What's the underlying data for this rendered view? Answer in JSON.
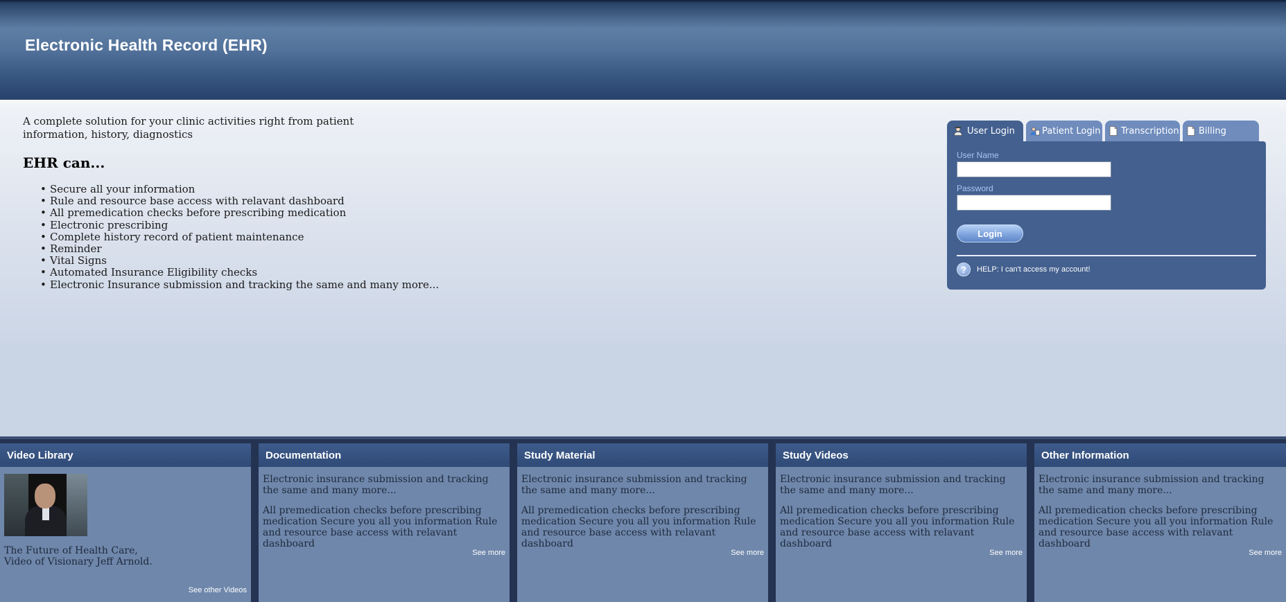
{
  "header": {
    "title": "Electronic Health Record (EHR)"
  },
  "intro": {
    "text": "A complete solution for your clinic activities right from patient information, history, diagnostics",
    "subheading": "EHR can...",
    "features": [
      "Secure all your information",
      "Rule and resource base access with relavant dashboard",
      "All premedication checks before prescribing medication",
      "Electronic prescribing",
      "Complete history record of patient maintenance",
      "Reminder",
      "Vital Signs",
      "Automated Insurance Eligibility checks",
      "Electronic Insurance submission and tracking the same and many more..."
    ]
  },
  "login": {
    "tabs": [
      {
        "label": "User Login",
        "icon": "user-icon",
        "active": true
      },
      {
        "label": "Patient Login",
        "icon": "patient-icon",
        "active": false
      },
      {
        "label": "Transcription",
        "icon": "document-icon",
        "active": false
      },
      {
        "label": "Billing",
        "icon": "document-icon",
        "active": false
      }
    ],
    "username_label": "User Name",
    "username_value": "",
    "password_label": "Password",
    "password_value": "",
    "login_button": "Login",
    "help_text": "HELP: I can't access my account!"
  },
  "bottom": {
    "video_library": {
      "title": "Video Library",
      "caption_line1": "The Future of Health Care,",
      "caption_line2": "Video of Visionary Jeff Arnold.",
      "link": "See other Videos"
    },
    "columns": [
      {
        "title": "Documentation",
        "para1": "Electronic insurance submission and tracking the same and many more...",
        "para2": "All premedication checks before prescribing medication Secure you all you information Rule and resource base access with relavant dashboard",
        "link": "See more"
      },
      {
        "title": "Study Material",
        "para1": "Electronic insurance submission and tracking the same and many more...",
        "para2": "All premedication checks before prescribing medication Secure you all you information Rule and resource base access with relavant dashboard",
        "link": "See more"
      },
      {
        "title": "Study Videos",
        "para1": "Electronic insurance submission and tracking the same and many more...",
        "para2": "All premedication checks before prescribing medication Secure you all you information Rule and resource base access with relavant dashboard",
        "link": "See more"
      },
      {
        "title": "Other Information",
        "para1": "Electronic insurance submission and tracking the same and many more...",
        "para2": "All premedication checks before prescribing medication Secure you all you information Rule and resource base access with relavant dashboard",
        "link": "See more"
      }
    ]
  },
  "colors": {
    "header_dark": "#26406a",
    "panel_blue": "#43608f",
    "tab_blue": "#6f8cbd",
    "column_bg": "#6f87ab",
    "field_label": "#a8c8f4"
  }
}
